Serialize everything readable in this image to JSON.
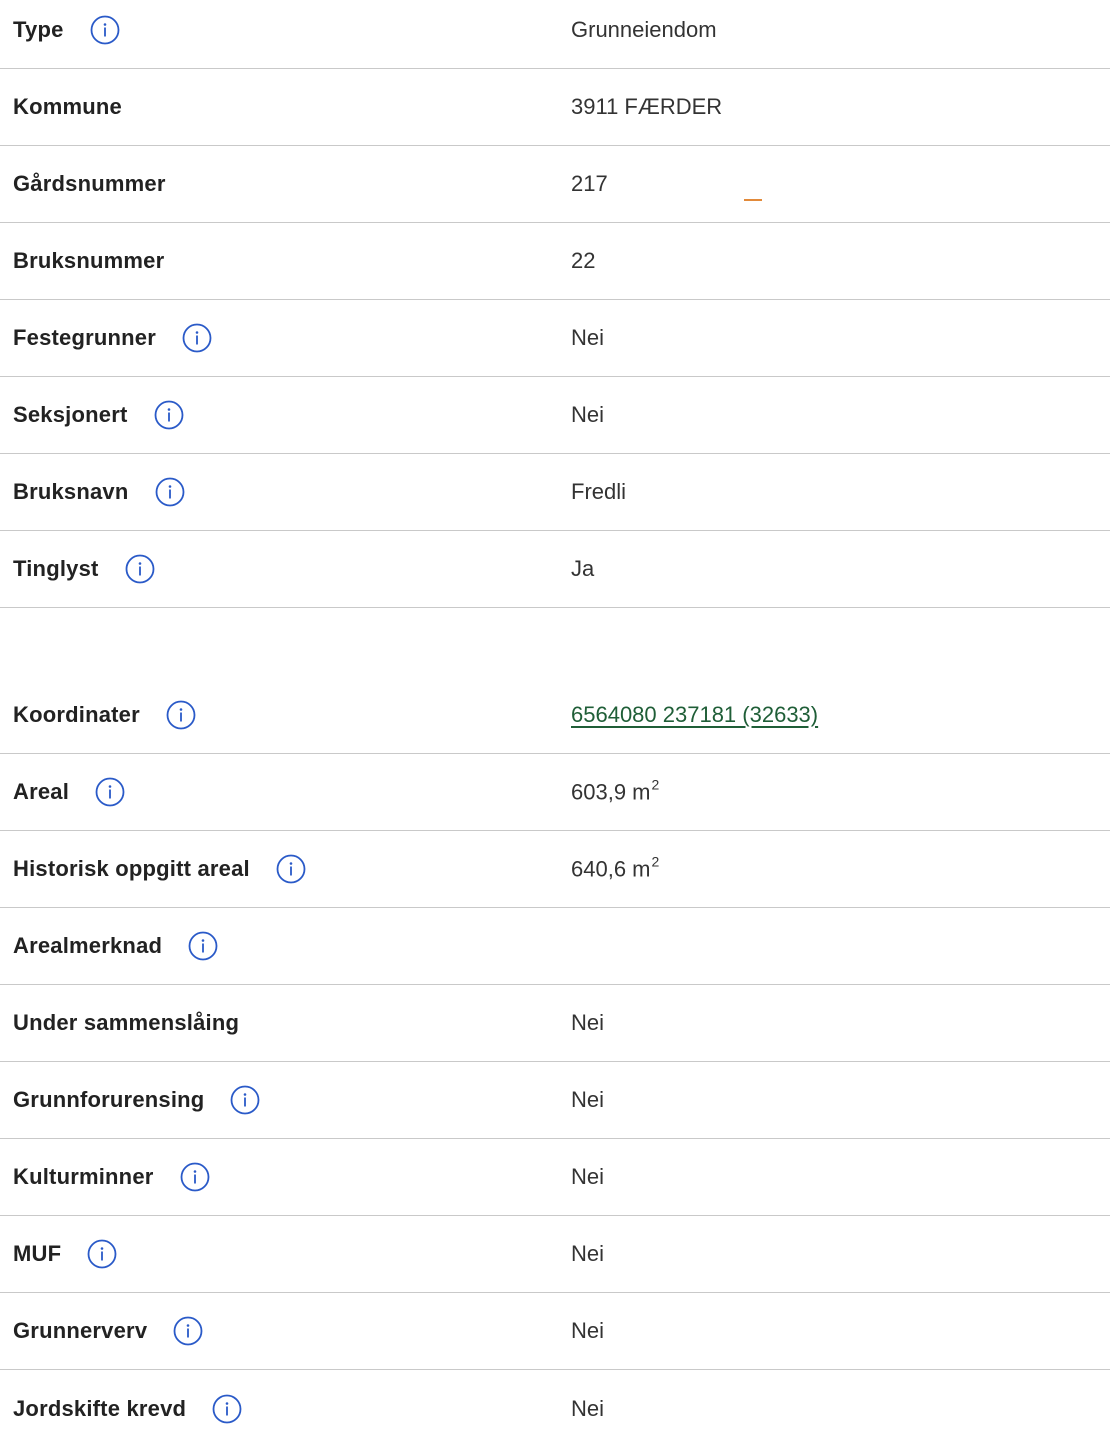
{
  "colors": {
    "label": "#222222",
    "value": "#333333",
    "divider": "#c9c9c9",
    "info_icon": "#2a5ac8",
    "link": "#1f5e37"
  },
  "section1": {
    "rows": [
      {
        "label": "Type",
        "value": "Grunneiendom",
        "info": true
      },
      {
        "label": "Kommune",
        "value": "3911 FÆRDER",
        "info": false
      },
      {
        "label": "Gårdsnummer",
        "value": "217",
        "info": false
      },
      {
        "label": "Bruksnummer",
        "value": "22",
        "info": false
      },
      {
        "label": "Festegrunner",
        "value": "Nei",
        "info": true
      },
      {
        "label": "Seksjonert",
        "value": "Nei",
        "info": true
      },
      {
        "label": "Bruksnavn",
        "value": "Fredli",
        "info": true
      },
      {
        "label": "Tinglyst",
        "value": "Ja",
        "info": true
      }
    ]
  },
  "section2": {
    "koordinater": {
      "label": "Koordinater",
      "value": "6564080 237181 (32633)"
    },
    "areal": {
      "label": "Areal",
      "value": "603,9 m",
      "unit_sup": "2"
    },
    "historisk": {
      "label": "Historisk oppgitt areal",
      "value": "640,6 m",
      "unit_sup": "2"
    },
    "arealmerknad": {
      "label": "Arealmerknad",
      "value": ""
    },
    "sammenslaing": {
      "label": "Under sammenslåing",
      "value": "Nei"
    },
    "grunnforurensing": {
      "label": "Grunnforurensing",
      "value": "Nei"
    },
    "kulturminner": {
      "label": "Kulturminner",
      "value": "Nei"
    },
    "muf": {
      "label": "MUF",
      "value": "Nei"
    },
    "grunnerverv": {
      "label": "Grunnerverv",
      "value": "Nei"
    },
    "jordskifte": {
      "label": "Jordskifte krevd",
      "value": "Nei"
    }
  }
}
